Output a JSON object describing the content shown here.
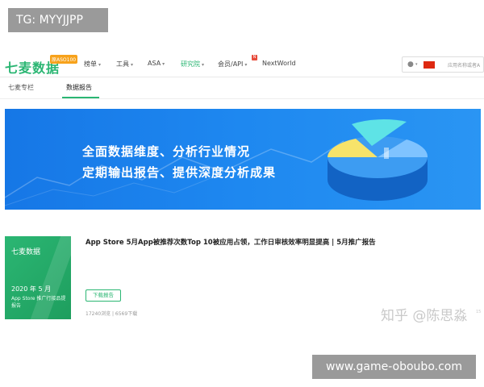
{
  "watermark_top": "TG: MYYJJPP",
  "watermark_bottom": "www.game-oboubo.com",
  "nav": {
    "logo": "七麦数据",
    "logo_badge": "原ASO100",
    "menu": [
      {
        "label": "榜单",
        "caret": "▾"
      },
      {
        "label": "工具",
        "caret": "▾"
      },
      {
        "label": "ASA",
        "caret": "▾"
      },
      {
        "label": "研究院",
        "caret": "▾"
      },
      {
        "label": "会员/API",
        "caret": "▾"
      },
      {
        "label": "NextWorld",
        "caret": ""
      }
    ],
    "new_badge": "N",
    "search_placeholder": "应用名称或者A"
  },
  "subtabs": [
    "七麦专栏",
    "数据报告"
  ],
  "banner": {
    "line1": "全面数据维度、分析行业情况",
    "line2": "定期输出报告、提供深度分析成果",
    "colors": {
      "background": "#1677e6",
      "pie_yellow": "#f7e36a",
      "pie_cyan": "#5ee3e6",
      "pie_blue": "#4aa8f5"
    }
  },
  "article": {
    "thumb_brand": "七麦数据",
    "thumb_year": "2020 年 5 月",
    "thumb_desc": "App Store 推广行接品提报告",
    "title": "App Store 5月App被推荐次数Top 10被应用占领，工作日审核效率明显提高 | 5月推广报告",
    "download_label": "下载报告",
    "stats": "17240浏览  |  6569下载"
  },
  "zhihu_watermark": "知乎 @陈思淼",
  "zhihu_small": "15",
  "colors": {
    "accent": "#2bb673",
    "badge": "#f7a21b",
    "new": "#e74c3c"
  }
}
